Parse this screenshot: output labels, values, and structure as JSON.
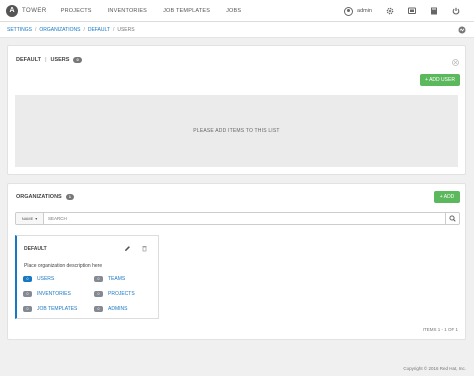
{
  "nav": {
    "logo_letter": "A",
    "brand": "TOWER",
    "links": [
      "PROJECTS",
      "INVENTORIES",
      "JOB TEMPLATES",
      "JOBS"
    ],
    "user": "admin",
    "icons": [
      "user-icon",
      "gear-icon",
      "portal-icon",
      "docs-book-icon",
      "logout-icon"
    ]
  },
  "breadcrumb": {
    "items": [
      "SETTINGS",
      "ORGANIZATIONS",
      "DEFAULT",
      "USERS"
    ]
  },
  "users_panel": {
    "title": "DEFAULT",
    "divider": "|",
    "subtitle": "USERS",
    "count": "0",
    "add_button": "+ ADD USER",
    "empty_text": "PLEASE ADD ITEMS TO THIS LIST"
  },
  "orgs_panel": {
    "title": "ORGANIZATIONS",
    "count": "1",
    "add_button": "+ ADD",
    "search_field": "NAME",
    "search_placeholder": "SEARCH",
    "card": {
      "name": "DEFAULT",
      "description": "Place organization description here",
      "links": [
        {
          "count": "0",
          "label": "USERS",
          "active": true
        },
        {
          "count": "0",
          "label": "TEAMS",
          "active": false
        },
        {
          "count": "0",
          "label": "INVENTORIES",
          "active": false
        },
        {
          "count": "0",
          "label": "PROJECTS",
          "active": false
        },
        {
          "count": "0",
          "label": "JOB TEMPLATES",
          "active": false
        },
        {
          "count": "0",
          "label": "ADMINS",
          "active": false
        }
      ]
    },
    "items_text": "ITEMS 1 - 1 OF 1"
  },
  "footer": {
    "copyright": "Copyright © 2016 Red Hat, Inc."
  },
  "colors": {
    "accent": "#1778c4",
    "success": "#5cb85c"
  }
}
